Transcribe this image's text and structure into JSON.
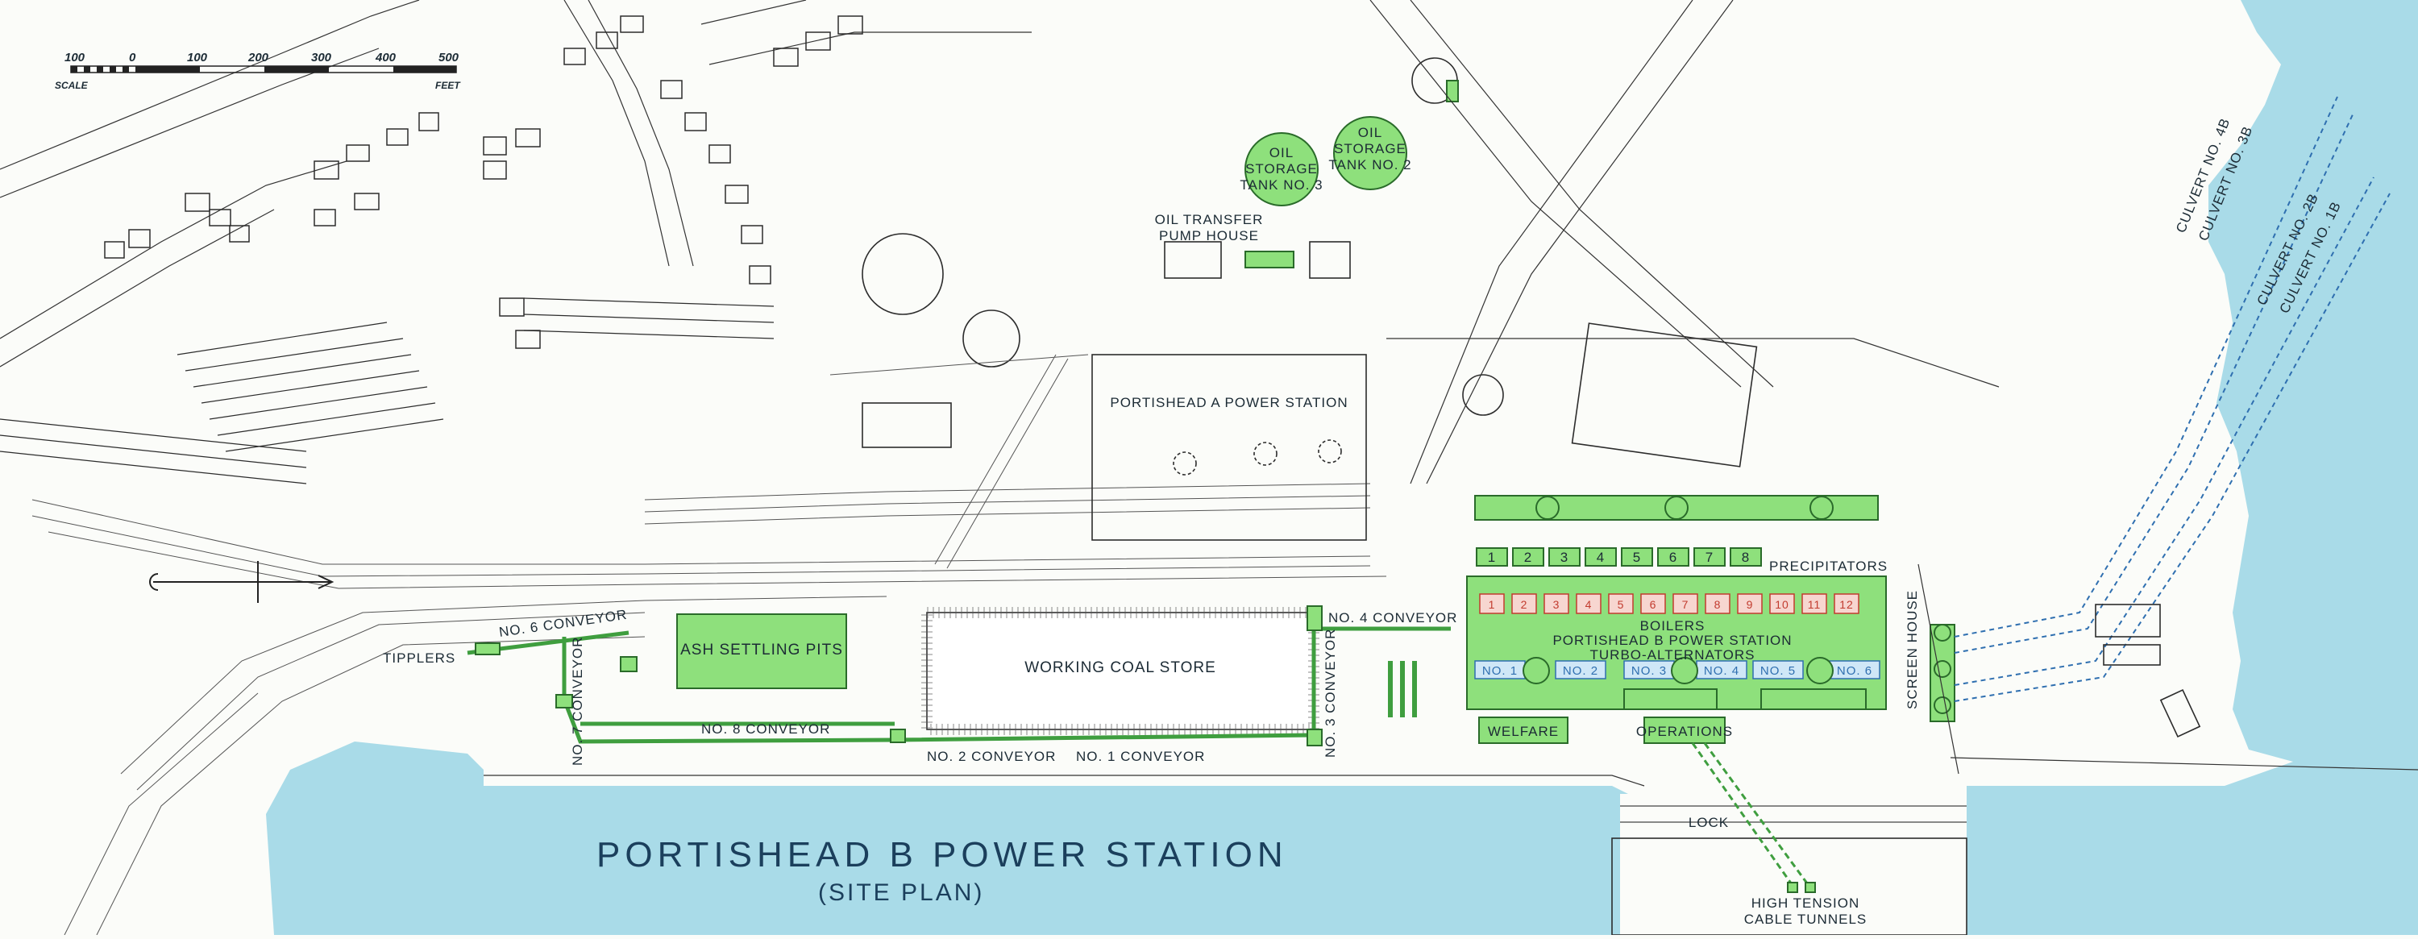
{
  "title": {
    "main": "PORTISHEAD  B  POWER  STATION",
    "sub": "(SITE PLAN)"
  },
  "scale_bar": {
    "ticks": [
      "100",
      "0",
      "100",
      "200",
      "300",
      "400",
      "500"
    ],
    "left_label": "SCALE",
    "right_label": "FEET"
  },
  "labels": {
    "oil_tank_3": [
      "OIL",
      "STORAGE",
      "TANK NO. 3"
    ],
    "oil_tank_2": [
      "OIL",
      "STORAGE",
      "TANK NO. 2"
    ],
    "oil_pump": [
      "OIL TRANSFER",
      "PUMP HOUSE"
    ],
    "station_a": "PORTISHEAD A POWER STATION",
    "ash": "ASH SETTLING PITS",
    "coal": "WORKING COAL STORE",
    "tipplers": "TIPPLERS",
    "conv6": "NO. 6 CONVEYOR",
    "conv7": "NO. 7 CONVEYOR",
    "conv8": "NO. 8 CONVEYOR",
    "conv2": "NO. 2 CONVEYOR",
    "conv1": "NO. 1 CONVEYOR",
    "conv3": "NO. 3 CONVEYOR",
    "conv4": "NO. 4 CONVEYOR",
    "precipitators": "PRECIPITATORS",
    "boilers": "BOILERS",
    "station_b": "PORTISHEAD B POWER STATION",
    "turbo": "TURBO-ALTERNATORS",
    "screen": "SCREEN HOUSE",
    "welfare": "WELFARE",
    "operations": "OPERATIONS",
    "lock": "LOCK",
    "ht": [
      "HIGH TENSION",
      "CABLE TUNNELS"
    ],
    "culverts": [
      "CULVERT NO. 4B",
      "CULVERT NO. 3B",
      "CULVERT NO. 2B",
      "CULVERT NO. 1B"
    ]
  },
  "precipitator_numbers": [
    "1",
    "2",
    "3",
    "4",
    "5",
    "6",
    "7",
    "8"
  ],
  "boiler_numbers": [
    "1",
    "2",
    "3",
    "4",
    "5",
    "6",
    "7",
    "8",
    "9",
    "10",
    "11",
    "12"
  ],
  "turbo_numbers": [
    "NO. 1",
    "NO. 2",
    "NO. 3",
    "NO. 4",
    "NO. 5",
    "NO. 6"
  ],
  "colors": {
    "water": "#a9dbe8",
    "plant_green": "#8ee07c",
    "conveyor": "#3f9e3f",
    "boiler_red": "#c23b2e",
    "turbo_blue": "#2f6fb0"
  }
}
